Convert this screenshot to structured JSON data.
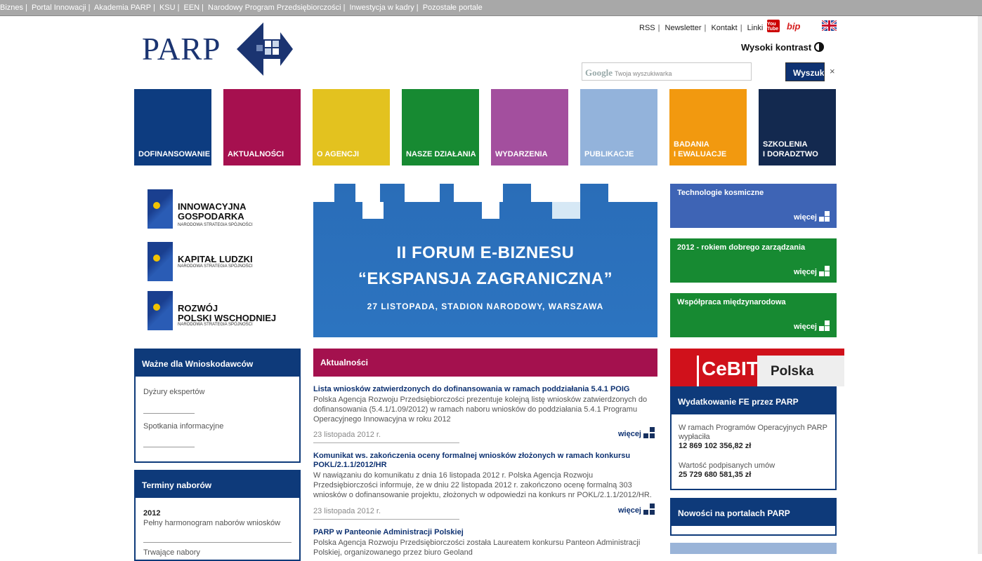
{
  "topbar": {
    "links": [
      "Biznes",
      "Portal Innowacji",
      "Akademia PARP",
      "KSU",
      "EEN",
      "Narodowy Program Przedsiębiorczości",
      "Inwestycja w kadry",
      "Pozostałe portale"
    ]
  },
  "logo": {
    "text": "PARP"
  },
  "toplinks": [
    "RSS",
    "Newsletter",
    "Kontakt",
    "Linki"
  ],
  "icons": {
    "youtube": "You Tube",
    "bip": "bip"
  },
  "high_contrast": "Wysoki kontrast",
  "search": {
    "placeholder": "Twoja wyszukiwarka",
    "google": "Google",
    "button": "Wyszukaj",
    "clear": "×"
  },
  "nav": [
    {
      "label": "DOFINANSOWANIE",
      "color": "#0d3c80"
    },
    {
      "label": "AKTUALNOŚCI",
      "color": "#a6104f"
    },
    {
      "label": "O AGENCJI",
      "color": "#e3c21f"
    },
    {
      "label": "NASZE DZIAŁANIA",
      "color": "#178a32"
    },
    {
      "label": "WYDARZENIA",
      "color": "#a34f9e"
    },
    {
      "label": "PUBLIKACJE",
      "color": "#93b3db"
    },
    {
      "label": "BADANIA\nI EWALUACJE",
      "color": "#f2990f"
    },
    {
      "label": "SZKOLENIA\nI DORADZTWO",
      "color": "#13294f"
    }
  ],
  "eu_programs": [
    {
      "line1": "INNOWACYJNA",
      "line2": "GOSPODARKA",
      "sub": "NARODOWA STRATEGIA SPÓJNOŚCI"
    },
    {
      "line1": "KAPITAŁ LUDZKI",
      "line2": "",
      "sub": "NARODOWA STRATEGIA SPÓJNOŚCI"
    },
    {
      "line1": "ROZWÓJ",
      "line2": "POLSKI WSCHODNIEJ",
      "sub": "NARODOWA STRATEGIA SPÓJNOŚCI"
    }
  ],
  "banner": {
    "line1": "II FORUM E-BIZNESU",
    "line2": "“EKSPANSJA ZAGRANICZNA”",
    "line3": "27 LISTOPADA, STADION NARODOWY, WARSZAWA"
  },
  "promos": [
    {
      "title": "Technologie kosmiczne",
      "more": "więcej",
      "color": "#3e64b5"
    },
    {
      "title": "2012 - rokiem dobrego zarządzania",
      "more": "więcej",
      "color": "#178a32"
    },
    {
      "title": "Współpraca międzynarodowa",
      "more": "więcej",
      "color": "#178a32"
    }
  ],
  "cebit": {
    "logo": "CeBIT",
    "country": "Polska"
  },
  "wazne": {
    "title": "Ważne dla Wnioskodawców",
    "items": [
      "Dyżury ekspertów",
      "Spotkania informacyjne"
    ]
  },
  "terminy": {
    "title": "Terminy naborów",
    "year": "2012",
    "item": "Pełny harmonogram naborów wniosków",
    "next": "Trwające nabory"
  },
  "news": {
    "title": "Aktualności",
    "items": [
      {
        "title": "Lista wniosków zatwierdzonych do dofinansowania w ramach poddziałania 5.4.1 POIG",
        "body": "Polska Agencja Rozwoju Przedsiębiorczości prezentuje kolejną listę wniosków zatwierdzonych do dofinansowania (5.4.1/1.09/2012) w ramach naboru wniosków do poddziałania 5.4.1 Programu Operacyjnego Innowacyjna w roku 2012",
        "date": "23 listopada 2012 r.",
        "more": "więcej"
      },
      {
        "title": "Komunikat ws. zakończenia oceny formalnej wniosków złożonych w ramach konkursu POKL/2.1.1/2012/HR",
        "body": "W nawiązaniu do komunikatu z dnia 16 listopada 2012 r. Polska Agencja Rozwoju Przedsiębiorczości informuje, że w dniu 22 listopada 2012 r. zakończono ocenę formalną 303 wniosków o dofinansowanie projektu, złożonych w odpowiedzi na konkurs nr POKL/2.1.1/2012/HR.",
        "date": "23 listopada 2012 r.",
        "more": "więcej"
      },
      {
        "title": "PARP w Panteonie Administracji Polskiej",
        "body": "Polska Agencja Rozwoju Przedsiębiorczości została Laureatem konkursu Panteon Administracji Polskiej, organizowanego przez biuro Geoland",
        "date": "",
        "more": ""
      }
    ]
  },
  "wydat": {
    "title": "Wydatkowanie FE przez PARP",
    "label1": "W ramach Programów Operacyjnych PARP wypłaciła",
    "value1": "12 869 102 356,82 zł",
    "label2": "Wartość podpisanych umów",
    "value2": "25 729 680 581,35 zł"
  },
  "nowosci": {
    "title": "Nowości na portalach PARP"
  }
}
